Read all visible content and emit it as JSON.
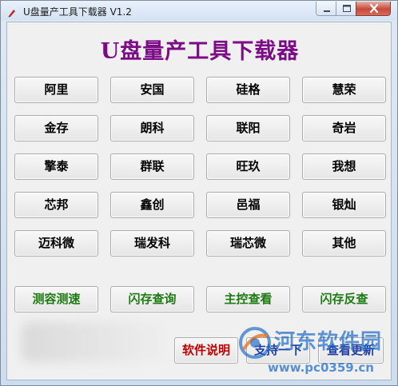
{
  "window": {
    "title": "U盘量产工具下载器 V1.2"
  },
  "heading": "U盘量产工具下载器",
  "vendors": [
    "阿里",
    "安国",
    "硅格",
    "慧荣",
    "金存",
    "朗科",
    "联阳",
    "奇岩",
    "擎泰",
    "群联",
    "旺玖",
    "我想",
    "芯邦",
    "鑫创",
    "邑福",
    "银灿",
    "迈科微",
    "瑞发科",
    "瑞芯微",
    "其他"
  ],
  "functions": [
    "测容测速",
    "闪存查询",
    "主控查看",
    "闪存反查"
  ],
  "footer": {
    "manual": "软件说明",
    "support": "支持一下",
    "update": "查看更新"
  },
  "watermark": {
    "name": "河东软件园",
    "url": "www.pc0359.cn"
  },
  "colors": {
    "heading": "#7c0c86",
    "function_text": "#1d7a13",
    "manual_text": "#c00000",
    "watermark": "#236ec8"
  }
}
